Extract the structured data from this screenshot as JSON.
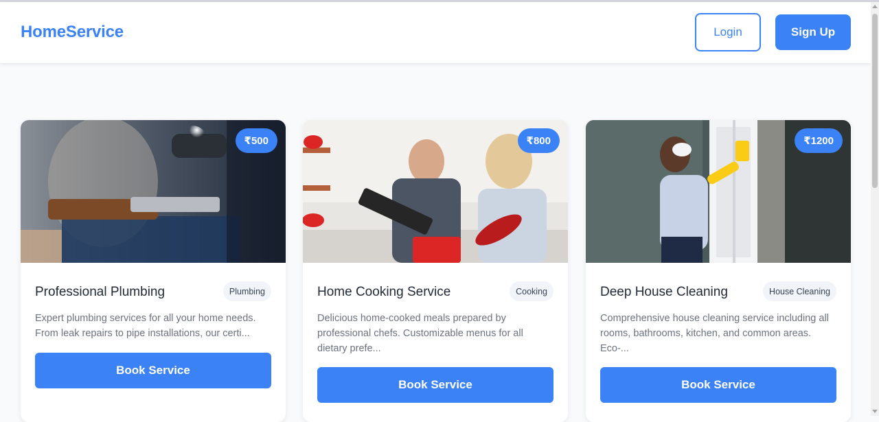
{
  "header": {
    "brand": "HomeService",
    "login_label": "Login",
    "signup_label": "Sign Up"
  },
  "colors": {
    "accent": "#3b82f6",
    "background": "#f8fafc",
    "card": "#ffffff",
    "title": "#1f2937",
    "muted": "#6b7280"
  },
  "services": [
    {
      "price": "₹500",
      "title": "Professional Plumbing",
      "category": "Plumbing",
      "description": "Expert plumbing services for all your home needs. From leak repairs to pipe installations, our certi...",
      "button_label": "Book Service",
      "image": "plumber-with-torch-photo"
    },
    {
      "price": "₹800",
      "title": "Home Cooking Service",
      "category": "Cooking",
      "description": "Delicious home-cooked meals prepared by professional chefs. Customizable menus for all dietary prefe...",
      "button_label": "Book Service",
      "image": "couple-cooking-photo"
    },
    {
      "price": "₹1200",
      "title": "Deep House Cleaning",
      "category": "House Cleaning",
      "description": "Comprehensive house cleaning service including all rooms, bathrooms, kitchen, and common areas. Eco-...",
      "button_label": "Book Service",
      "image": "cleaning-window-photo"
    }
  ]
}
